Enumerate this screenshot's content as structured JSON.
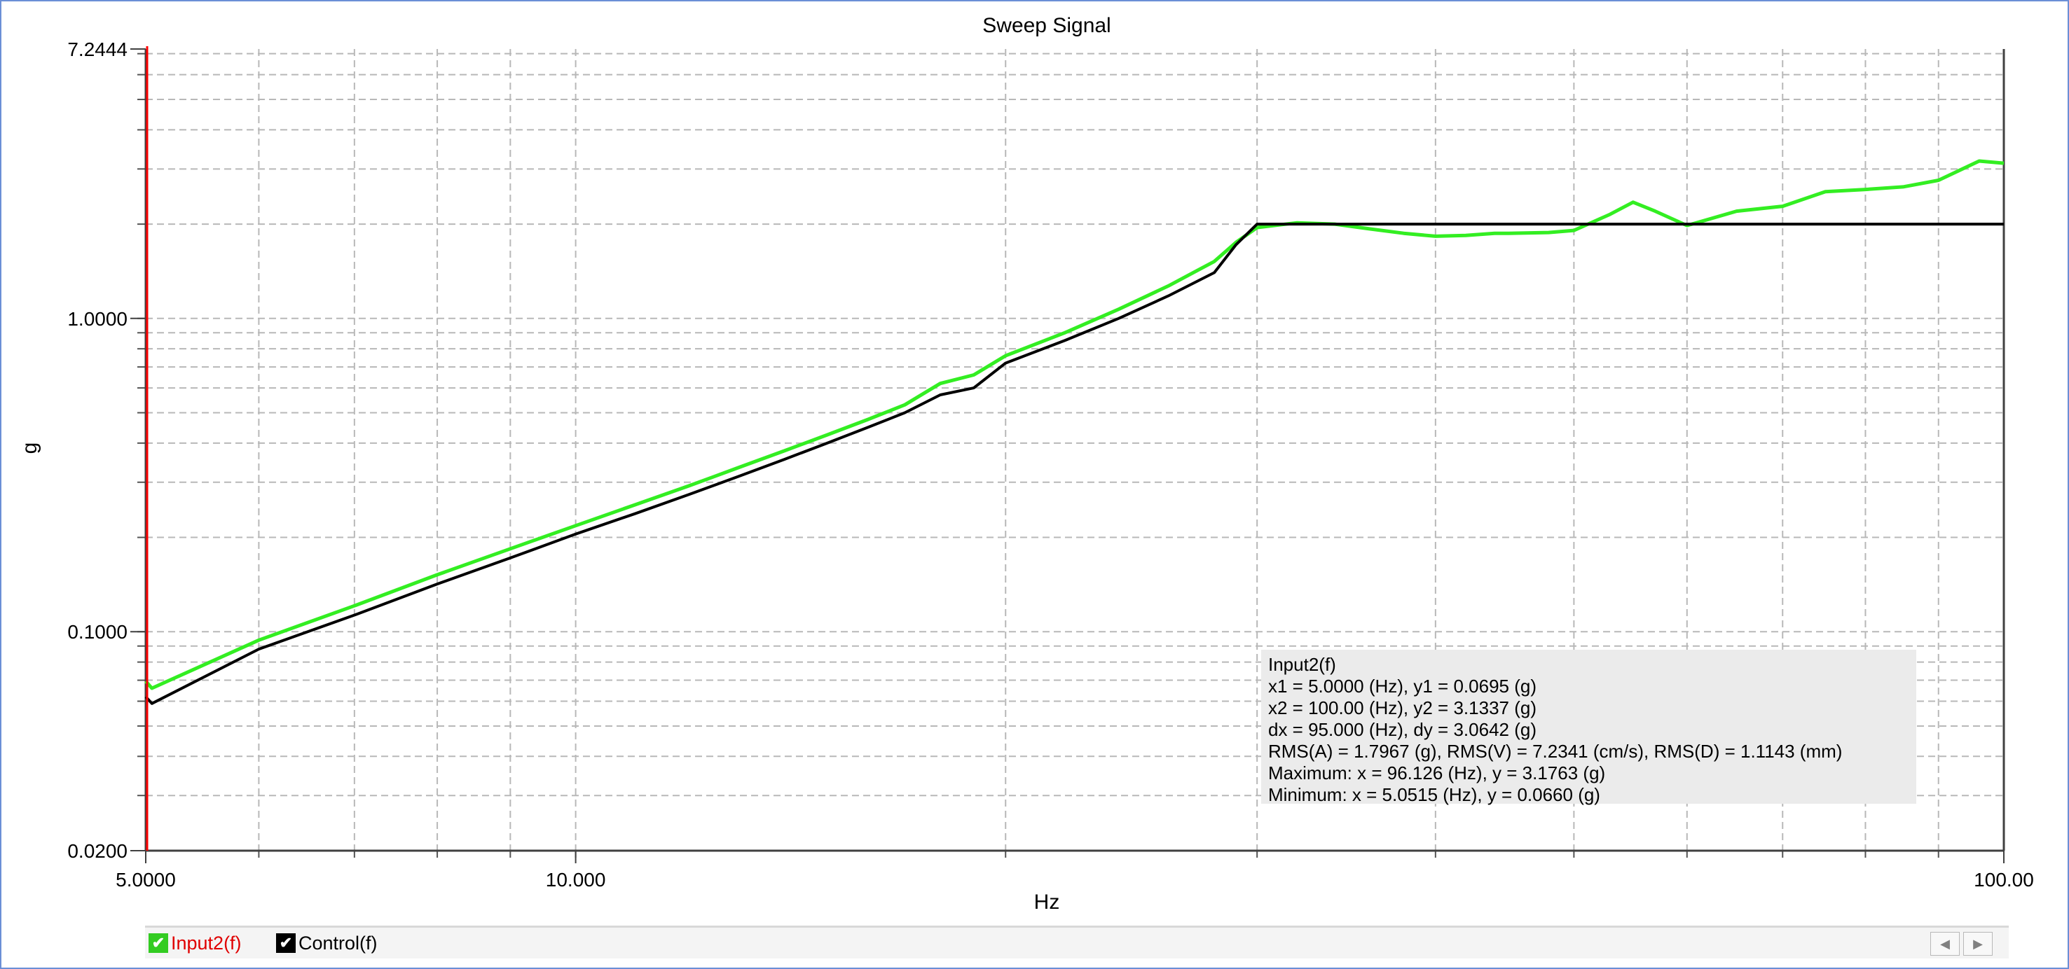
{
  "chart_data": {
    "type": "line",
    "title": "Sweep Signal",
    "xlabel": "Hz",
    "ylabel": "g",
    "x_scale": "log",
    "y_scale": "log",
    "xlim": [
      5.0,
      100.0
    ],
    "ylim": [
      0.02,
      7.2444
    ],
    "x_tick_labels": [
      "5.0000",
      "10.000",
      "100.00"
    ],
    "y_tick_labels": [
      "7.2444",
      "1.0000",
      "0.1000",
      "0.0200"
    ],
    "grid": true,
    "legend_placement": "bottom",
    "series": [
      {
        "name": "Input2(f)",
        "color": "#33ee22",
        "x": [
          5.0,
          5.05,
          6,
          7,
          8,
          9,
          10,
          11,
          12,
          13,
          14,
          15,
          16,
          17,
          18,
          19,
          20,
          22,
          24,
          26,
          28,
          29,
          30,
          32,
          34,
          36,
          38,
          40,
          42,
          44,
          45,
          48,
          50,
          53,
          55,
          57,
          60,
          65,
          70,
          75,
          80,
          85,
          90,
          96.1,
          100
        ],
        "y": [
          0.0695,
          0.066,
          0.094,
          0.121,
          0.152,
          0.184,
          0.218,
          0.254,
          0.292,
          0.334,
          0.378,
          0.425,
          0.475,
          0.53,
          0.62,
          0.66,
          0.76,
          0.9,
          1.07,
          1.27,
          1.52,
          1.75,
          1.95,
          2.02,
          2.0,
          1.93,
          1.87,
          1.83,
          1.84,
          1.87,
          1.87,
          1.88,
          1.91,
          2.15,
          2.35,
          2.2,
          1.98,
          2.2,
          2.28,
          2.54,
          2.58,
          2.63,
          2.76,
          3.18,
          3.13
        ]
      },
      {
        "name": "Control(f)",
        "color": "#000000",
        "x": [
          5.0,
          5.05,
          6,
          7,
          8,
          9,
          10,
          11,
          12,
          13,
          14,
          15,
          16,
          17,
          18,
          19,
          20,
          22,
          24,
          26,
          28,
          29,
          30,
          40,
          50,
          60,
          70,
          80,
          90,
          100
        ],
        "y": [
          0.062,
          0.059,
          0.088,
          0.113,
          0.142,
          0.172,
          0.205,
          0.238,
          0.274,
          0.313,
          0.355,
          0.4,
          0.448,
          0.5,
          0.57,
          0.6,
          0.72,
          0.85,
          1.0,
          1.18,
          1.4,
          1.72,
          2.0,
          2.0,
          2.0,
          2.0,
          2.0,
          2.0,
          2.0,
          2.0
        ]
      }
    ],
    "annotation": {
      "lines": [
        "Input2(f)",
        "x1 = 5.0000 (Hz), y1 = 0.0695 (g)",
        "x2 = 100.00 (Hz), y2 = 3.1337 (g)",
        "dx = 95.000 (Hz), dy = 3.0642 (g)",
        "RMS(A) = 1.7967 (g), RMS(V) = 7.2341 (cm/s), RMS(D) = 1.1143 (mm)",
        "Maximum: x = 96.126 (Hz), y = 3.1763 (g)",
        "Minimum: x = 5.0515 (Hz), y = 0.0660 (g)"
      ]
    },
    "cursor": {
      "x": 5.0,
      "color": "#ff0000"
    }
  },
  "legend": {
    "items": [
      {
        "label": "Input2(f)",
        "label_color": "#e00000",
        "check_color": "#33cc22"
      },
      {
        "label": "Control(f)",
        "label_color": "#000000",
        "check_color": "#000000"
      }
    ]
  },
  "nav": {
    "prev_icon": "chevron-left-icon",
    "next_icon": "chevron-right-icon"
  }
}
